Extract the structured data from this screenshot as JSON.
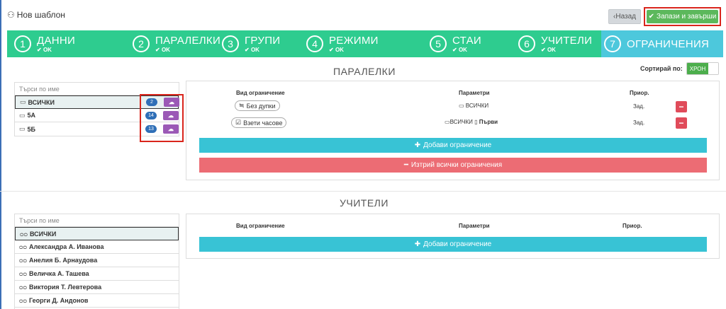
{
  "header": {
    "title": "Нов шаблон",
    "back_label": "Назад",
    "save_label": "Запази и завърши"
  },
  "steps": [
    {
      "num": "1",
      "label": "ДАННИ",
      "status": "OK"
    },
    {
      "num": "2",
      "label": "ПАРАЛЕЛКИ",
      "status": "OK"
    },
    {
      "num": "3",
      "label": "ГРУПИ",
      "status": "OK"
    },
    {
      "num": "4",
      "label": "РЕЖИМИ",
      "status": "OK"
    },
    {
      "num": "5",
      "label": "СТАИ",
      "status": "OK"
    },
    {
      "num": "6",
      "label": "УЧИТЕЛИ",
      "status": "OK"
    },
    {
      "num": "7",
      "label": "ОГРАНИЧЕНИЯ",
      "status": ""
    }
  ],
  "sort": {
    "label": "Сортирай по:",
    "toggle": "ХРОН"
  },
  "classes": {
    "title": "ПАРАЛЕЛКИ",
    "search_placeholder": "Търси по име",
    "items": [
      {
        "name": "ВСИЧКИ",
        "count": "2"
      },
      {
        "name": "5А",
        "count": "14"
      },
      {
        "name": "5Б",
        "count": "13"
      }
    ],
    "table": {
      "col_type": "Вид ограничение",
      "col_params": "Параметри",
      "col_prio": "Приор.",
      "rows": [
        {
          "type": "Без дупки",
          "params": "ВСИЧКИ",
          "params_extra": "",
          "prio": "Зад."
        },
        {
          "type": "Взети часове",
          "params": "ВСИЧКИ",
          "params_extra": "Първи",
          "prio": "Зад."
        }
      ]
    },
    "add_label": "Добави ограничение",
    "remove_all_label": "Изтрий всички ограничения"
  },
  "teachers": {
    "title": "УЧИТЕЛИ",
    "search_placeholder": "Търси по име",
    "items": [
      {
        "name": "ВСИЧКИ"
      },
      {
        "name": "Александра А. Иванова"
      },
      {
        "name": "Анелия Б. Арнаудова"
      },
      {
        "name": "Величка А. Ташева"
      },
      {
        "name": "Виктория Т. Левтерова"
      },
      {
        "name": "Георги Д. Андонов"
      }
    ],
    "table": {
      "col_type": "Вид ограничение",
      "col_params": "Параметри",
      "col_prio": "Приор."
    },
    "add_label": "Добави ограничение"
  },
  "colors": {
    "stepper_bg": "#2ecc8f",
    "stepper_active": "#4dc8dc",
    "save_green": "#5cb85c",
    "badge_blue": "#2f6fb7",
    "cloud_purple": "#9b59b6",
    "add_cyan": "#38c3d5",
    "remove_red": "#ec6c74",
    "highlight_red": "#d9251c"
  }
}
